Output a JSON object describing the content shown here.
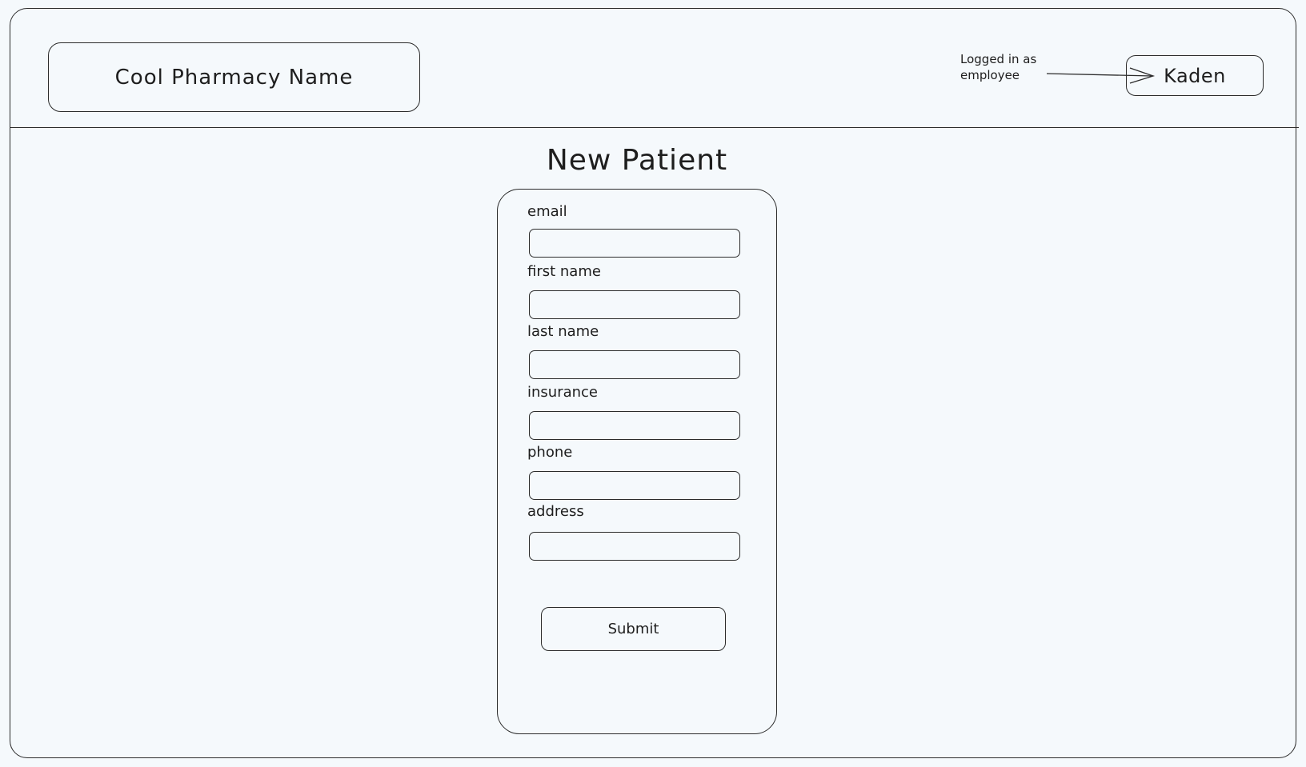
{
  "header": {
    "brand_name": "Cool Pharmacy Name",
    "login_note": "Logged in as employee",
    "user_name": "Kaden"
  },
  "form": {
    "title": "New Patient",
    "fields": [
      {
        "label": "email",
        "value": "",
        "placeholder": ""
      },
      {
        "label": "first name",
        "value": "",
        "placeholder": ""
      },
      {
        "label": "last name",
        "value": "",
        "placeholder": ""
      },
      {
        "label": "insurance",
        "value": "",
        "placeholder": ""
      },
      {
        "label": "phone",
        "value": "",
        "placeholder": ""
      },
      {
        "label": "address",
        "value": "",
        "placeholder": ""
      }
    ],
    "submit_label": "Submit"
  }
}
